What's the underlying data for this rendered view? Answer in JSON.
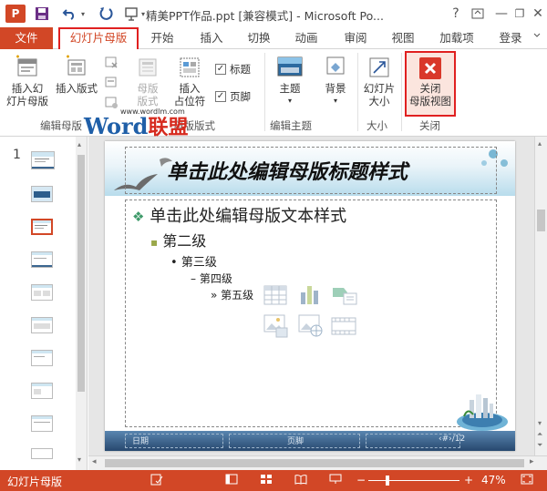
{
  "window": {
    "logo": "P",
    "title": "精美PPT作品.ppt [兼容模式] - Microsoft Po...",
    "help": "?",
    "minimize": "—",
    "restore": "❐",
    "close": "✕"
  },
  "tabs": {
    "file": "文件",
    "slide_master": "幻灯片母版",
    "home": "开始",
    "insert": "插入",
    "transitions": "切换",
    "animations": "动画",
    "review": "审阅",
    "view": "视图",
    "addins": "加载项",
    "login": "登录"
  },
  "ribbon": {
    "insert_master_1": "插入幻",
    "insert_master_2": "灯片母版",
    "insert_layout": "插入版式",
    "master_layout_1": "母版",
    "master_layout_2": "版式",
    "insert_placeholder_1": "插入",
    "insert_placeholder_2": "占位符",
    "title_check": "标题",
    "footer_check": "页脚",
    "group_edit_master": "编辑母版",
    "group_master_layout": "母版版式",
    "theme": "主题",
    "background": "背景",
    "group_edit_theme": "编辑主题",
    "slide_size_1": "幻灯片",
    "slide_size_2": "大小",
    "group_size": "大小",
    "close_master_1": "关闭",
    "close_master_2": "母版视图",
    "group_close": "关闭"
  },
  "watermark": {
    "word": "Word",
    "cn": "联盟",
    "url": "www.wordlm.com"
  },
  "thumbnails": {
    "number": "1"
  },
  "slide": {
    "title": "单击此处编辑母版标题样式",
    "level1": "单击此处编辑母版文本样式",
    "level2": "第二级",
    "level3": "第三级",
    "level4": "第四级",
    "level5": "第五级",
    "bullet1": "❖",
    "bullet2": "▪",
    "bullet3": "•",
    "bullet4": "–",
    "bullet5": "»",
    "footer_date": "日期",
    "footer_text": "页脚",
    "footer_num": "‹#›/12"
  },
  "status": {
    "mode": "幻灯片母版",
    "zoom": "47%",
    "zoom_level_pct": 47,
    "minus": "−",
    "plus": "+"
  }
}
